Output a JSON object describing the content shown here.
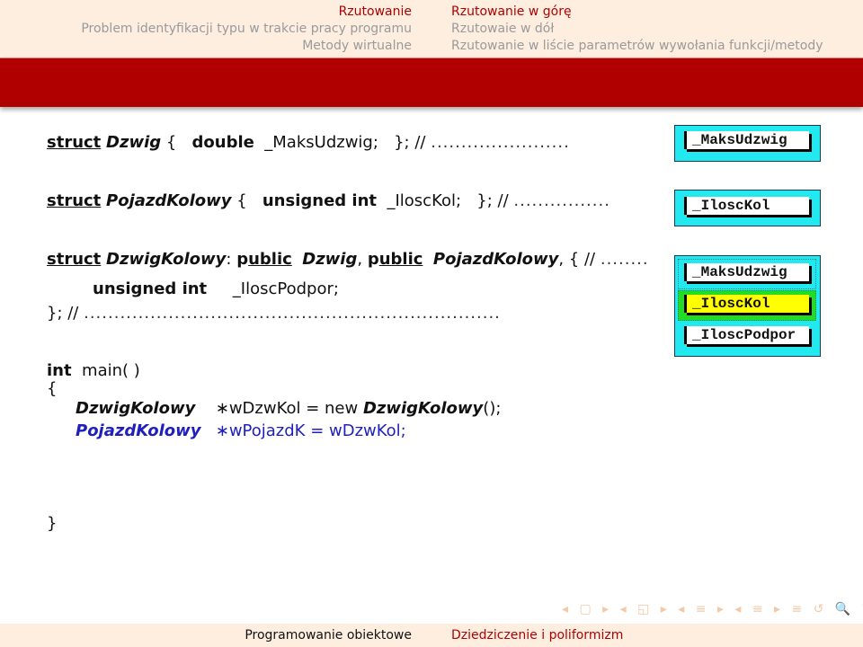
{
  "header": {
    "left_items": [
      {
        "label": "Rzutowanie",
        "active": true
      },
      {
        "label": "Problem identyfikacji typu w trakcie pracy programu",
        "active": false
      },
      {
        "label": "Metody wirtualne",
        "active": false
      }
    ],
    "right_items": [
      {
        "label": "Rzutowanie w górę",
        "active": true
      },
      {
        "label": "Rzutowaie w dół",
        "active": false
      },
      {
        "label": "Rzutowanie w liście parametrów wywołania funkcji/metody",
        "active": false
      }
    ]
  },
  "code": {
    "line1": {
      "kw": "struct",
      "name": "Dzwig",
      "brace": "{",
      "type": "double",
      "field": "_MaksUdzwig;",
      "end": "};",
      "comment": "//",
      "dots": "......................."
    },
    "line2": {
      "kw": "struct",
      "name": "PojazdKolowy",
      "brace": "{",
      "type": "unsigned int",
      "field": "_IloscKol;",
      "end": "};",
      "comment": "//",
      "dots": "................"
    },
    "line3": {
      "kw": "struct",
      "name": "DzwigKolowy",
      "colon": ":",
      "p1": "p",
      "pub1": "ublic",
      "base1": "Dzwig",
      "comma1": ",",
      "p2": "p",
      "pub2": "ublic",
      "base2": "PojazdKolowy",
      "tail": ", { //",
      "dots": "........"
    },
    "line4": {
      "type": "unsigned int",
      "field": "_IloscPodpor;"
    },
    "line5": {
      "end": "}; //",
      "dots": "....................................................................."
    },
    "main": {
      "kw": "int",
      "sig": "main( )",
      "open": "{",
      "close": "}"
    },
    "stmt1": {
      "type": "DzwigKolowy",
      "var": "∗wDzwKol = new ",
      "ctor": "DzwigKolowy",
      "tail": "();"
    },
    "stmt2": {
      "type": "PojazdKolowy",
      "var": "∗wPojazdK = wDzwKol;"
    }
  },
  "memory_boxes": {
    "dzwig": [
      "_MaksUdzwig"
    ],
    "pojazd": [
      "_IloscKol"
    ],
    "dzwig_kolowy": [
      "_MaksUdzwig",
      "_IloscKol",
      "_IloscPodpor"
    ],
    "highlighted": "_IloscKol"
  },
  "nav_symbols": "◂ ▢ ▸ ◂ ◱ ▸ ◂ ≡ ▸ ◂ ≡ ▸   ≡   ↺ 🔍 ↻",
  "footer": {
    "left": "Programowanie obiektowe",
    "right": "Dziedziczenie i poliformizm"
  },
  "colors": {
    "accent": "#b00000",
    "box": "#22e8f0",
    "highlight": "#ffff00",
    "highlight_border": "#22dd22",
    "blue_text": "#1f1fbf"
  }
}
